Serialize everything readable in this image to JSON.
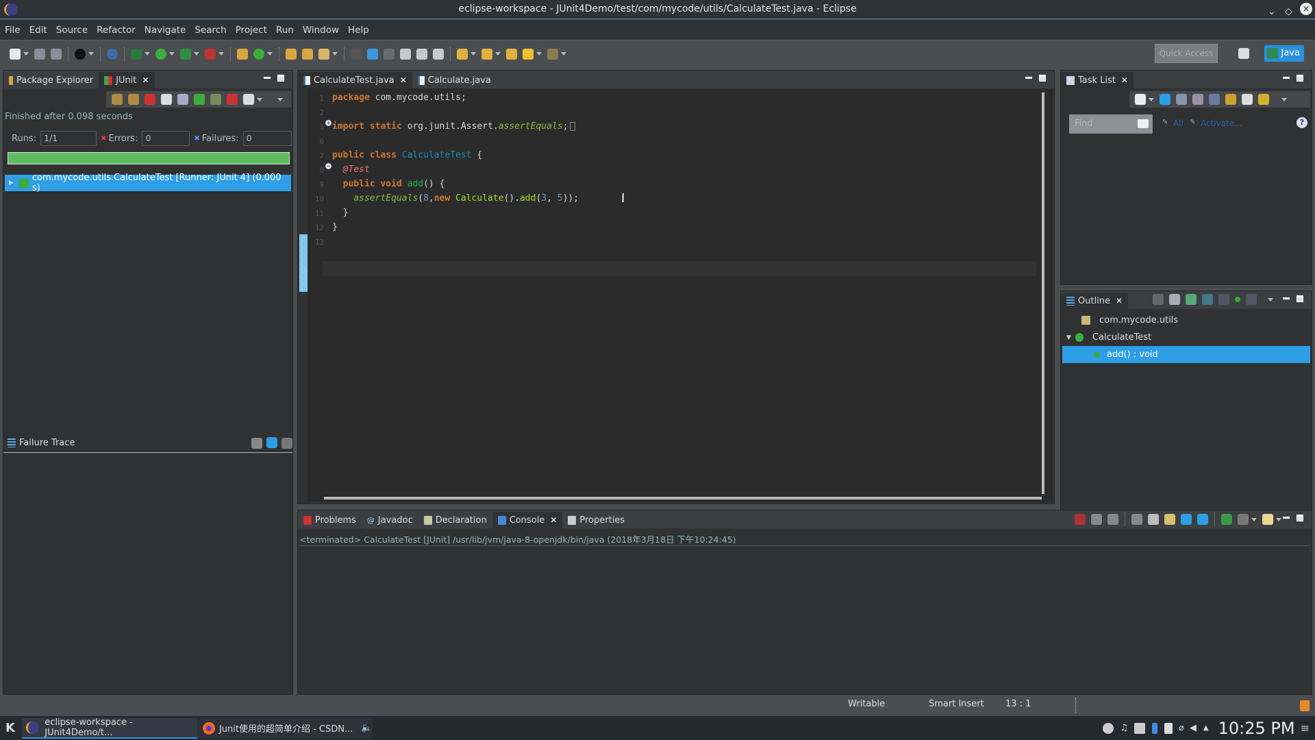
{
  "window": {
    "title": "eclipse-workspace - JUnit4Demo/test/com/mycode/utils/CalculateTest.java - Eclipse"
  },
  "menu": [
    "File",
    "Edit",
    "Source",
    "Refactor",
    "Navigate",
    "Search",
    "Project",
    "Run",
    "Window",
    "Help"
  ],
  "toolbar": {
    "quick_access_placeholder": "Quick Access",
    "perspective_label": "Java"
  },
  "left_panel": {
    "tabs": [
      {
        "label": "Package Explorer",
        "icon": "package-explorer-icon"
      },
      {
        "label": "JUnit",
        "icon": "junit-icon",
        "active": true
      }
    ],
    "status": "Finished after 0.098 seconds",
    "runs_label": "Runs:",
    "runs_value": "1/1",
    "errors_label": "Errors:",
    "errors_value": "0",
    "failures_label": "Failures:",
    "failures_value": "0",
    "progress": 1.0,
    "progress_color": "#5ebd5e",
    "tree": [
      {
        "label": "com.mycode.utils.CalculateTest [Runner: JUnit 4] (0.000 s)",
        "selected": true
      }
    ],
    "failure_trace_label": "Failure Trace"
  },
  "editor": {
    "tabs": [
      {
        "label": "CalculateTest.java",
        "active": true
      },
      {
        "label": "Calculate.java"
      }
    ],
    "line_numbers": [
      "1",
      "2",
      "3",
      "6",
      "7",
      "8",
      "9",
      "10",
      "11",
      "12",
      "13"
    ],
    "lines": [
      {
        "n": "1",
        "tokens": [
          [
            "kw",
            "package"
          ],
          [
            "",
            " com.mycode.utils;"
          ]
        ]
      },
      {
        "n": "2",
        "tokens": []
      },
      {
        "n": "3",
        "tokens": [
          [
            "kw",
            "import"
          ],
          [
            "",
            " "
          ],
          [
            "kw",
            "static"
          ],
          [
            "",
            " org.junit.Assert."
          ],
          [
            "it",
            "assertEquals"
          ],
          [
            "",
            ";"
          ]
        ],
        "fold": "plus"
      },
      {
        "n": "6",
        "tokens": []
      },
      {
        "n": "7",
        "tokens": [
          [
            "kw",
            "public"
          ],
          [
            "",
            " "
          ],
          [
            "kw",
            "class"
          ],
          [
            "",
            " "
          ],
          [
            "cls",
            "CalculateTest"
          ],
          [
            "",
            " {"
          ]
        ]
      },
      {
        "n": "8",
        "tokens": [
          [
            "",
            "  "
          ],
          [
            "ann",
            "@Test"
          ]
        ],
        "fold": "minus"
      },
      {
        "n": "9",
        "tokens": [
          [
            "",
            "  "
          ],
          [
            "kw",
            "public"
          ],
          [
            "",
            " "
          ],
          [
            "kw",
            "void"
          ],
          [
            "",
            " "
          ],
          [
            "mth",
            "add"
          ],
          [
            "",
            "() {"
          ]
        ]
      },
      {
        "n": "10",
        "tokens": [
          [
            "",
            "    "
          ],
          [
            "it",
            "assertEquals"
          ],
          [
            "",
            "("
          ],
          [
            "num",
            "8"
          ],
          [
            "",
            ","
          ],
          [
            "kw",
            "new"
          ],
          [
            "",
            " "
          ],
          [
            "cal",
            "Calculate"
          ],
          [
            "",
            "()."
          ],
          [
            "cal",
            "add"
          ],
          [
            "",
            "("
          ],
          [
            "num",
            "3"
          ],
          [
            "",
            ", "
          ],
          [
            "num",
            "5"
          ],
          [
            "",
            "));"
          ]
        ]
      },
      {
        "n": "11",
        "tokens": [
          [
            "",
            "  }"
          ]
        ]
      },
      {
        "n": "12",
        "tokens": [
          [
            "",
            "}"
          ]
        ]
      },
      {
        "n": "13",
        "tokens": []
      }
    ]
  },
  "task_list": {
    "tab_label": "Task List",
    "find_placeholder": "Find",
    "all_label": "All",
    "activate_label": "Activate..."
  },
  "outline": {
    "tab_label": "Outline",
    "items": [
      {
        "label": "com.mycode.utils",
        "icon": "package-icon"
      },
      {
        "label": "CalculateTest",
        "icon": "class-icon",
        "expanded": true
      },
      {
        "label": "add() : void",
        "icon": "method-icon",
        "selected": true
      }
    ]
  },
  "bottom_panel": {
    "tabs": [
      {
        "label": "Problems"
      },
      {
        "label": "Javadoc"
      },
      {
        "label": "Declaration"
      },
      {
        "label": "Console",
        "active": true
      },
      {
        "label": "Properties"
      }
    ],
    "console_header": "<terminated> CalculateTest [JUnit] /usr/lib/jvm/java-8-openjdk/bin/java (2018年3月18日 下午10:24:45)"
  },
  "statusbar": {
    "writable": "Writable",
    "insert_mode": "Smart Insert",
    "position": "13 : 1"
  },
  "taskbar": {
    "tasks": [
      {
        "label": "eclipse-workspace - JUnit4Demo/t...",
        "active": true
      },
      {
        "label": "Junit使用的超简单介绍 - CSDN..."
      }
    ],
    "clock": "10:25 PM"
  }
}
